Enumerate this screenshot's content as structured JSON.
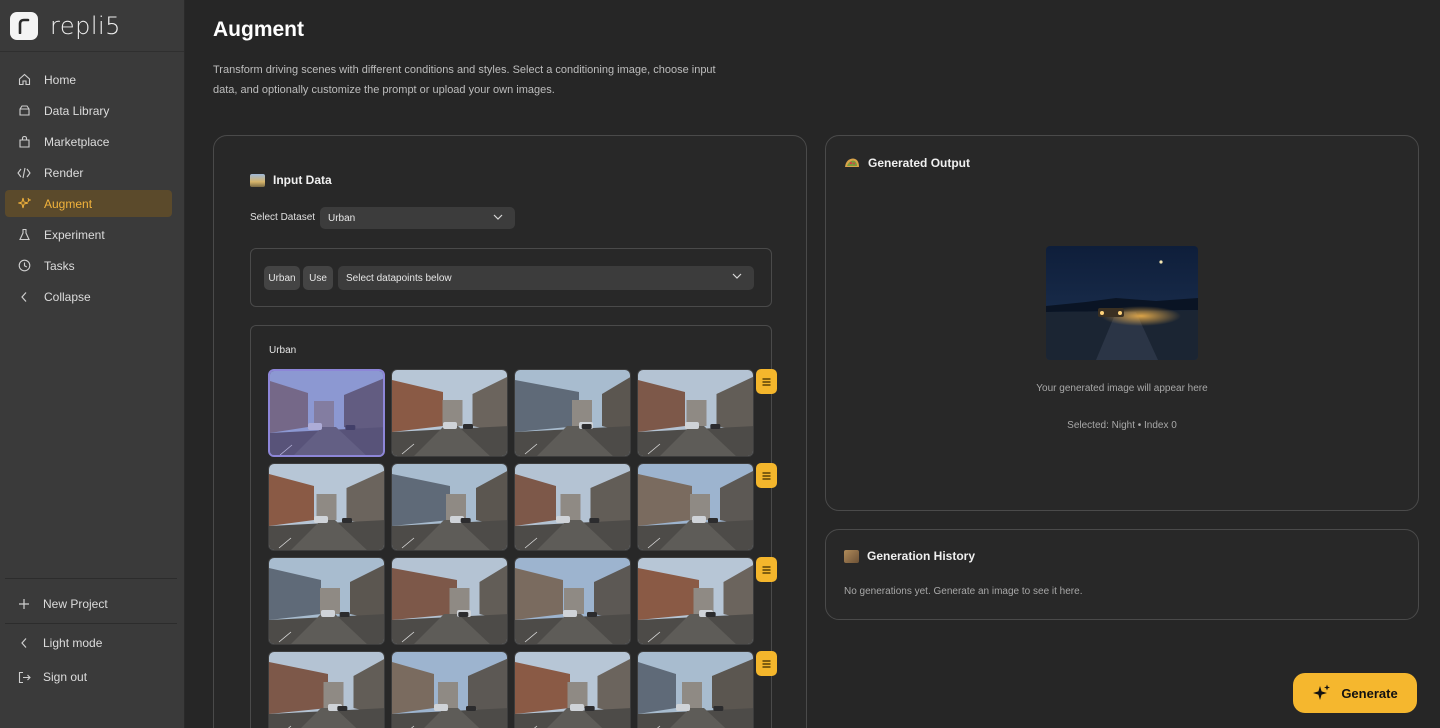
{
  "app": {
    "name": "repli5"
  },
  "sidebar": {
    "items": [
      {
        "label": "Home",
        "icon": "home-icon"
      },
      {
        "label": "Data Library",
        "icon": "database-icon"
      },
      {
        "label": "Marketplace",
        "icon": "bag-icon"
      },
      {
        "label": "Render",
        "icon": "code-icon"
      },
      {
        "label": "Augment",
        "icon": "sparkle-icon",
        "active": true
      },
      {
        "label": "Experiment",
        "icon": "flask-icon"
      },
      {
        "label": "Tasks",
        "icon": "clock-icon"
      },
      {
        "label": "Collapse",
        "icon": "chevron-left-icon"
      }
    ],
    "bottom": [
      {
        "label": "New Project",
        "icon": "plus-icon"
      },
      {
        "label": "Light mode",
        "icon": "chevron-left-icon"
      },
      {
        "label": "Sign out",
        "icon": "sign-out-icon"
      }
    ]
  },
  "page": {
    "title": "Augment",
    "description": "Transform driving scenes with different conditions and styles. Select a conditioning image, choose input data, and optionally customize the prompt or upload your own images."
  },
  "input": {
    "title": "Input Data",
    "dataset_label": "Select Dataset",
    "dataset_value": "Urban",
    "chips": [
      "Urban",
      "Use"
    ],
    "datapoints_placeholder": "Select datapoints below",
    "gallery_label": "Urban",
    "gallery_rows": 4,
    "gallery_cols": 4,
    "selected_index": 0
  },
  "output": {
    "title": "Generated Output",
    "hint": "Your generated image will appear here",
    "selected": "Selected: Night • Index 0"
  },
  "history": {
    "title": "Generation History",
    "empty": "No generations yet. Generate an image to see it here."
  },
  "actions": {
    "generate": "Generate"
  },
  "colors": {
    "accent": "#f5b72e",
    "active_nav_bg": "#5b4a2b",
    "selected_border": "#8d86d8"
  }
}
